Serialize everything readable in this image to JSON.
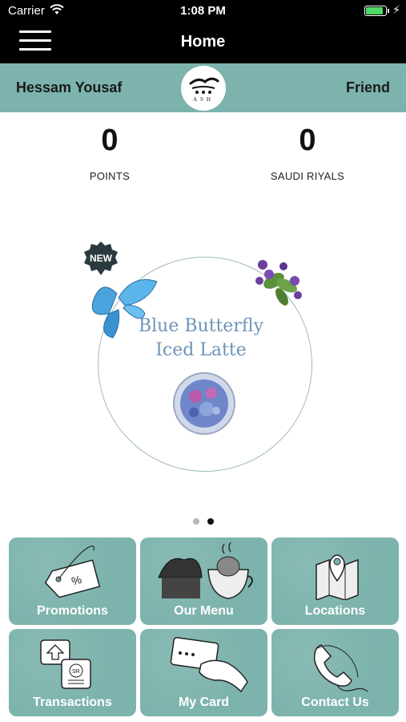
{
  "status_bar": {
    "carrier": "Carrier",
    "time": "1:08 PM",
    "battery_level": 0.9
  },
  "nav": {
    "title": "Home"
  },
  "profile": {
    "name": "Hessam Yousaf",
    "tier": "Friend",
    "logo_letters": "ASH"
  },
  "stats": {
    "points": {
      "value": "0",
      "label": "POINTS"
    },
    "riyals": {
      "value": "0",
      "label": "SAUDI RIYALS"
    }
  },
  "promo": {
    "badge": "NEW",
    "title_line1": "Blue Butterfly",
    "title_line2": "Iced Latte"
  },
  "carousel": {
    "page_count": 2,
    "active_index": 1
  },
  "tiles": [
    {
      "label": "Promotions",
      "icon": "price-tag-icon"
    },
    {
      "label": "Our Menu",
      "icon": "dessert-cup-icon"
    },
    {
      "label": "Locations",
      "icon": "map-pin-icon"
    },
    {
      "label": "Transactions",
      "icon": "transactions-icon"
    },
    {
      "label": "My Card",
      "icon": "card-in-hand-icon"
    },
    {
      "label": "Contact Us",
      "icon": "phone-icon"
    }
  ],
  "colors": {
    "teal": "#7cb3ac",
    "header": "#000000",
    "promo_text": "#6e94b8",
    "battery": "#4cd964"
  }
}
